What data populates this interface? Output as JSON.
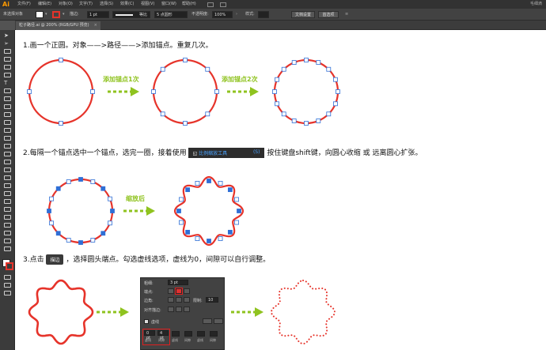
{
  "app": {
    "logo": "Ai"
  },
  "menu": {
    "items": [
      "文件(F)",
      "编辑(E)",
      "对象(O)",
      "文字(T)",
      "选择(S)",
      "效果(C)",
      "视图(V)",
      "窗口(W)",
      "帮助(H)"
    ],
    "right": "毛细滴"
  },
  "control_bar": {
    "selection_label": "未选择对象",
    "stroke_label": "描边:",
    "stroke_value": "1 pt",
    "profile_label": "等比",
    "brush_label": "5 点圆形",
    "opacity_label": "不透明度:",
    "opacity_value": "100%",
    "style_label": "样式:",
    "doc_setup_button": "文档设置",
    "prefs_button": "首选项"
  },
  "tab": {
    "title": "粒子路径.ai @ 200% (RGB/GPU 预览)",
    "close": "×"
  },
  "steps": {
    "step1": "1.画一个正圆。对象——>路径——>添加锚点。重复几次。",
    "step2_prefix": "2.每隔一个锚点选中一个锚点，选完一圈，接着使用",
    "step2_chip_label": "比例缩放工具",
    "step2_chip_key": "(S)",
    "step2_suffix": "按住键盘shift键，向圆心收缩 或 远离圆心扩张。",
    "step3_prefix": "3.点击",
    "step3_chip": "描边",
    "step3_suffix": "，选择圆头端点。勾选虚线选项，虚线为0，间隙可以自行调整。"
  },
  "labels": {
    "add_anchor_1": "添加锚点1次",
    "add_anchor_2": "添加锚点2次",
    "scale": "缩放后"
  },
  "stroke_panel": {
    "weight_label": "粗细:",
    "weight_value": "3 pt",
    "cap_label": "端点:",
    "corner_label": "边角:",
    "limit_label": "限制:",
    "limit_value": "10",
    "align_label": "对齐描边:",
    "dashed_label": "虚线",
    "dash_value": "0 pt",
    "gap_value": "4 pt",
    "dash_labels": [
      "虚线",
      "间隙",
      "虚线",
      "间隙",
      "虚线",
      "间隙"
    ]
  },
  "colors": {
    "accent_green": "#8fc31f",
    "path_red": "#e6332a",
    "anchor_blue": "#2f6fd6"
  }
}
